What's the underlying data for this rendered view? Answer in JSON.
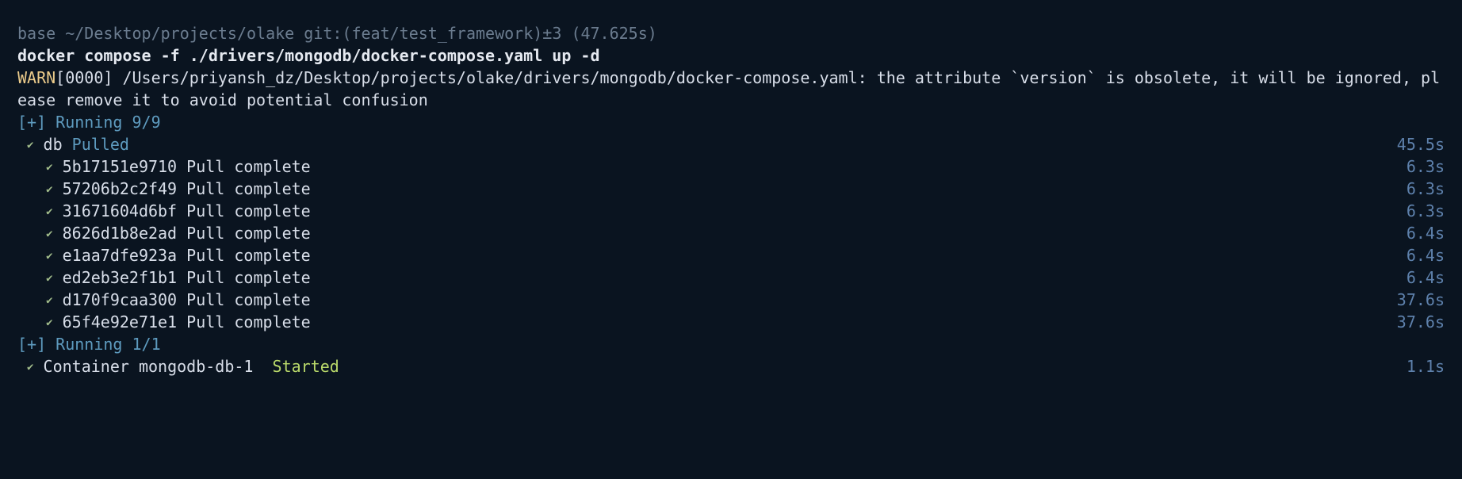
{
  "prompt": {
    "env": "base",
    "path": "~/Desktop/projects/olake",
    "git_prefix": "git:(",
    "branch": "feat/test_framework",
    "git_suffix": ")",
    "dirty": "±3",
    "timing": "(47.625s)"
  },
  "command": "docker compose -f ./drivers/mongodb/docker-compose.yaml up -d",
  "warn": {
    "tag": "WARN",
    "brace_open": "[",
    "code": "0000",
    "brace_close": "]",
    "rest": " /Users/priyansh_dz/Desktop/projects/olake/drivers/mongodb/docker-compose.yaml: the attribute `version` is obsolete, it will be ignored, please remove it to avoid potential confusion"
  },
  "status1": {
    "bracket": "[+]",
    "text": " Running 9/9"
  },
  "pulled": {
    "check": "✔",
    "name": "db",
    "status": "Pulled",
    "time": "45.5s"
  },
  "layers": [
    {
      "check": "✔",
      "hash": "5b17151e9710",
      "status": "Pull complete",
      "time": "6.3s"
    },
    {
      "check": "✔",
      "hash": "57206b2c2f49",
      "status": "Pull complete",
      "time": "6.3s"
    },
    {
      "check": "✔",
      "hash": "31671604d6bf",
      "status": "Pull complete",
      "time": "6.3s"
    },
    {
      "check": "✔",
      "hash": "8626d1b8e2ad",
      "status": "Pull complete",
      "time": "6.4s"
    },
    {
      "check": "✔",
      "hash": "e1aa7dfe923a",
      "status": "Pull complete",
      "time": "6.4s"
    },
    {
      "check": "✔",
      "hash": "ed2eb3e2f1b1",
      "status": "Pull complete",
      "time": "6.4s"
    },
    {
      "check": "✔",
      "hash": "d170f9caa300",
      "status": "Pull complete",
      "time": "37.6s"
    },
    {
      "check": "✔",
      "hash": "65f4e92e71e1",
      "status": "Pull complete",
      "time": "37.6s"
    }
  ],
  "status2": {
    "bracket": "[+]",
    "text": " Running 1/1"
  },
  "container": {
    "check": "✔",
    "label": "Container",
    "name": "mongodb-db-1",
    "status": "Started",
    "time": "1.1s"
  }
}
